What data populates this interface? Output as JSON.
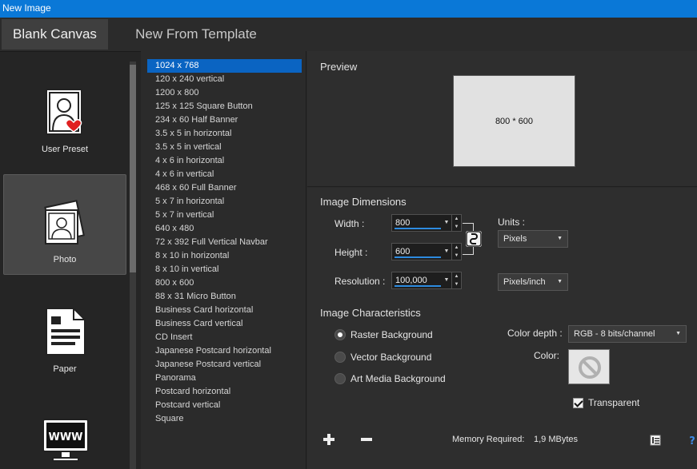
{
  "window": {
    "title": "New Image"
  },
  "tabs": [
    {
      "label": "Blank Canvas"
    },
    {
      "label": "New From Template"
    }
  ],
  "categories": [
    {
      "label": "User Preset",
      "icon": "user-preset-icon"
    },
    {
      "label": "Photo",
      "icon": "photo-icon",
      "selected": true
    },
    {
      "label": "Paper",
      "icon": "paper-icon"
    },
    {
      "label": "",
      "icon": "web-icon"
    }
  ],
  "presets": [
    "1024 x 768",
    "120 x 240 vertical",
    "1200 x 800",
    "125 x 125 Square Button",
    "234 x 60 Half Banner",
    "3.5 x 5 in horizontal",
    "3.5 x 5 in vertical",
    "4 x 6 in horizontal",
    "4 x 6 in vertical",
    "468 x 60 Full Banner",
    "5 x 7 in horizontal",
    "5 x 7 in vertical",
    "640 x 480",
    "72 x 392 Full Vertical Navbar",
    "8 x 10 in horizontal",
    "8 x 10 in vertical",
    "800 x 600",
    "88 x 31 Micro Button",
    "Business Card horizontal",
    "Business Card vertical",
    "CD Insert",
    "Japanese Postcard horizontal",
    "Japanese Postcard vertical",
    "Panorama",
    "Postcard horizontal",
    "Postcard vertical",
    "Square"
  ],
  "selected_preset": "1024 x 768",
  "preview": {
    "title": "Preview",
    "label": "800 * 600"
  },
  "dimensions": {
    "title": "Image Dimensions",
    "width_label": "Width :",
    "width_value": "800",
    "height_label": "Height :",
    "height_value": "600",
    "resolution_label": "Resolution :",
    "resolution_value": "100,000",
    "units_label": "Units :",
    "units_value": "Pixels",
    "resolution_units_value": "Pixels/inch"
  },
  "characteristics": {
    "title": "Image Characteristics",
    "options": [
      {
        "label": "Raster Background",
        "selected": true
      },
      {
        "label": "Vector Background",
        "selected": false
      },
      {
        "label": "Art Media Background",
        "selected": false
      }
    ],
    "color_depth_label": "Color depth :",
    "color_depth_value": "RGB - 8 bits/channel",
    "color_label": "Color:",
    "transparent_label": "Transparent",
    "transparent_checked": true
  },
  "footer": {
    "memory_label": "Memory Required:",
    "memory_value": "1,9 MBytes"
  },
  "colors": {
    "titlebar": "#0a78d7",
    "selection": "#0a64c2",
    "accent_underline": "#2d8be0",
    "no_color_icon": "#b0b0b0"
  }
}
